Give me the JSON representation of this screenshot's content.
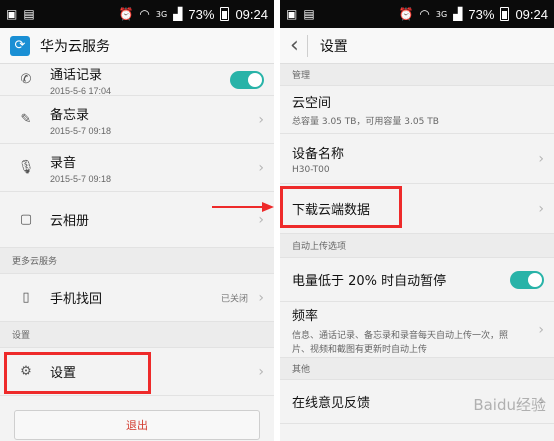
{
  "left": {
    "status": {
      "percent": "73%",
      "time": "09:24",
      "network": "3G"
    },
    "appbar": {
      "title": "华为云服务",
      "logo_icon": "cloud-sync-icon"
    },
    "items": [
      {
        "title": "通话记录",
        "sub": "2015-5-6 17:04",
        "icon": "phone-icon"
      },
      {
        "title": "备忘录",
        "sub": "2015-5-7 09:18",
        "icon": "memo-icon"
      },
      {
        "title": "录音",
        "sub": "2015-5-7 09:18",
        "icon": "microphone-icon"
      },
      {
        "title": "云相册",
        "icon": "gallery-icon"
      }
    ],
    "section_more": "更多云服务",
    "find_phone": {
      "title": "手机找回",
      "status": "已关闭",
      "icon": "phone-find-icon"
    },
    "section_settings": "设置",
    "settings": {
      "title": "设置",
      "icon": "gear-icon"
    },
    "logout": "退出"
  },
  "right": {
    "status": {
      "percent": "73%",
      "time": "09:24",
      "network": "3G"
    },
    "appbar": {
      "title": "设置",
      "back_icon": "back-arrow-icon"
    },
    "section_manage": "管理",
    "cloud_space": {
      "title": "云空间",
      "sub": "总容量 3.05 TB，可用容量 3.05 TB"
    },
    "device_name": {
      "title": "设备名称",
      "sub": "H30-T00"
    },
    "download": {
      "title": "下载云端数据"
    },
    "section_auto": "自动上传选项",
    "battery_pause": {
      "title": "电量低于 20% 时自动暂停",
      "enabled": true
    },
    "frequency": {
      "title": "频率",
      "sub1": "信息、通话记录、备忘录和录音每天自动上传一次，照",
      "sub2": "片、视频和截图有更新时自动上传"
    },
    "section_other": "其他",
    "feedback": {
      "title": "在线意见反馈"
    },
    "watermark": "Baidu经验"
  },
  "colors": {
    "accent": "#28b3a8",
    "highlight": "#ee2a2a",
    "logout": "#d23b2f"
  }
}
